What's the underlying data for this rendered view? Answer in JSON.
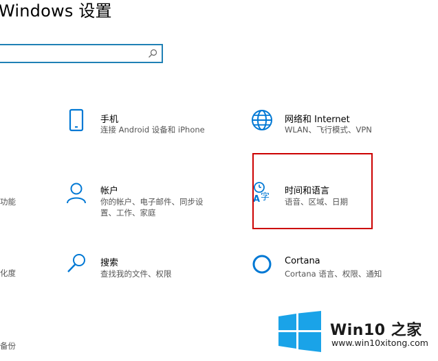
{
  "window": {
    "title": "Windows 设置"
  },
  "search": {
    "placeholder": ""
  },
  "tiles": {
    "phone": {
      "name": "手机",
      "desc": "连接 Android 设备和 iPhone"
    },
    "network": {
      "name": "网络和 Internet",
      "desc": "WLAN、飞行模式、VPN"
    },
    "accounts": {
      "name": "帐户",
      "desc": "你的帐户、电子邮件、同步设置、工作、家庭"
    },
    "time_language": {
      "name": "时间和语言",
      "desc": "语音、区域、日期"
    },
    "search": {
      "name": "搜索",
      "desc": "查找我的文件、权限"
    },
    "cortana": {
      "name": "Cortana",
      "desc": "Cortana 语言、权限、通知"
    }
  },
  "left_edge": {
    "row2": "功能",
    "row3": "化度",
    "row4": "备份"
  },
  "watermark": {
    "brand": "Win10 之家",
    "url": "www.win10xitong.com"
  },
  "colors": {
    "accent": "#0078d4",
    "highlight": "#cc0000",
    "logo_blue": "#1aa3e8"
  }
}
